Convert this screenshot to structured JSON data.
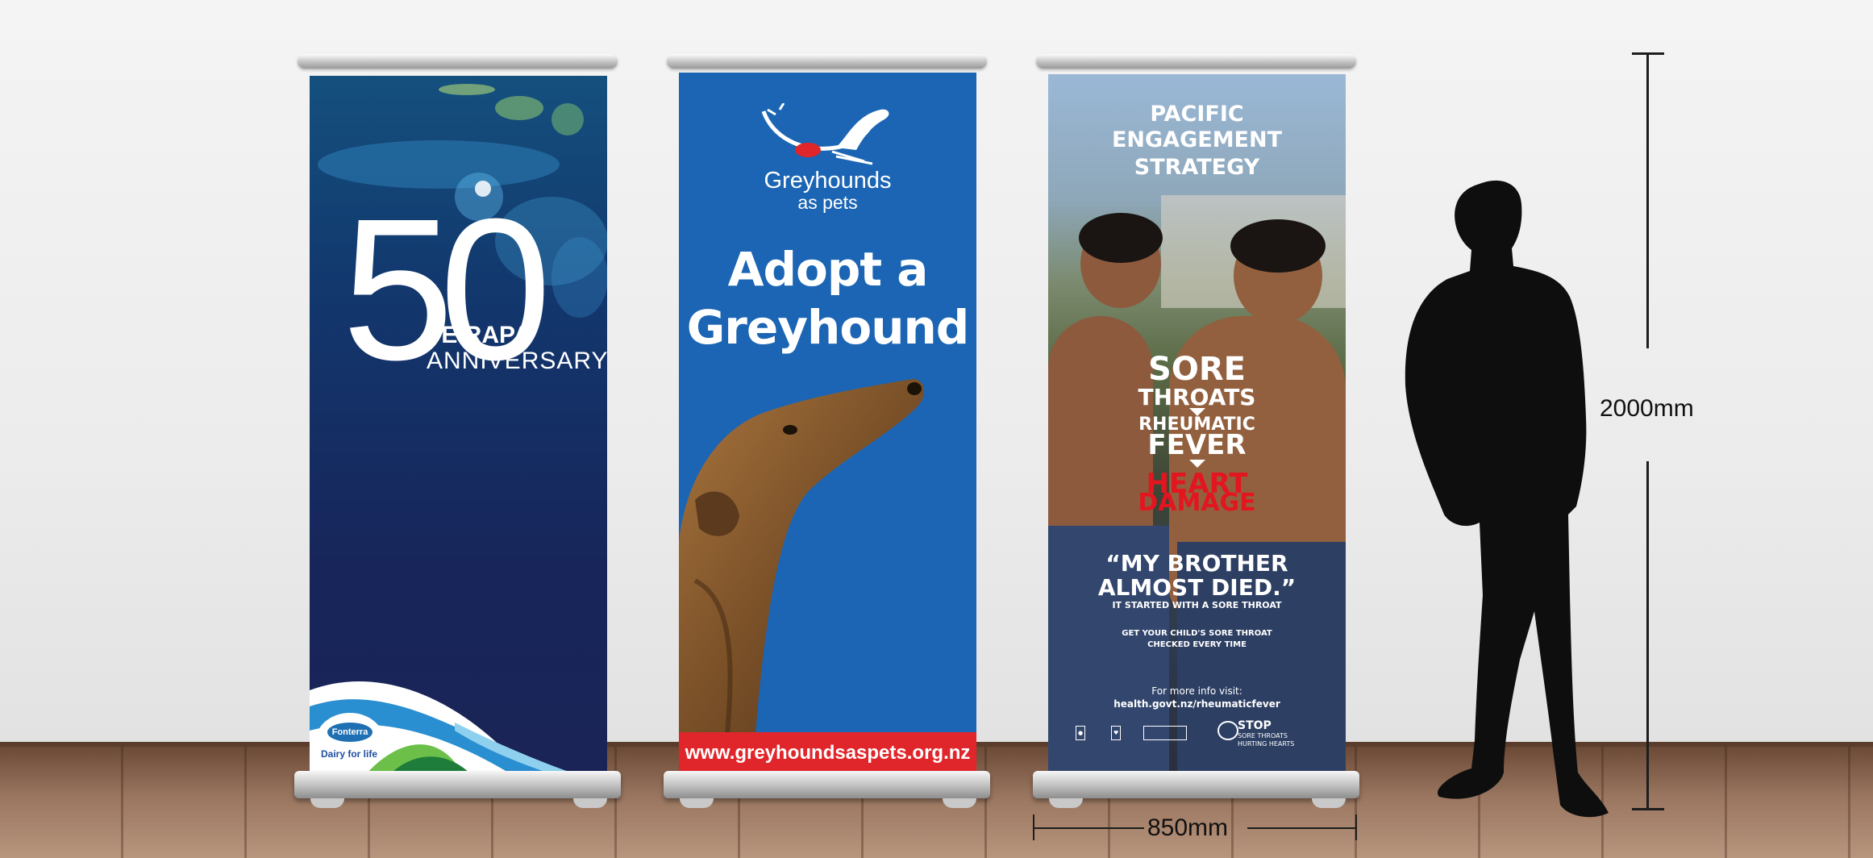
{
  "banner_fonterra": {
    "number": "50",
    "line1": "TE RAPA",
    "line2": "ANNIVERSARY",
    "logo_word": "Fonterra",
    "logo_tagline": "Dairy for life"
  },
  "banner_greyhound": {
    "brand_line1": "Greyhounds",
    "brand_line2": "as pets",
    "headline_line1": "Adopt a",
    "headline_line2": "Greyhound",
    "url": "www.greyhoundsaspets.org.nz"
  },
  "banner_health": {
    "title_line1": "PACIFIC",
    "title_line2": "ENGAGEMENT",
    "title_line3": "STRATEGY",
    "sore": "SORE",
    "throats": "THROATS",
    "rheumatic": "RHEUMATIC",
    "fever": "FEVER",
    "heart": "HEART",
    "damage": "DAMAGE",
    "quote_line1": "“MY BROTHER",
    "quote_line2": "ALMOST DIED.”",
    "quote_sub": "IT STARTED WITH A SORE THROAT",
    "check_line1": "GET YOUR CHILD'S SORE THROAT",
    "check_line2": "CHECKED EVERY TIME",
    "info_line1": "For more info visit:",
    "info_line2": "health.govt.nz/rheumaticfever",
    "stop_line1": "STOP",
    "stop_line2": "SORE THROATS",
    "stop_line3": "HURTING HEARTS"
  },
  "dimensions": {
    "height_label": "2000mm",
    "width_label": "850mm"
  },
  "colors": {
    "fonterra_navy": "#17255a",
    "greyhound_blue": "#1b65b4",
    "url_bar_red": "#e0262a",
    "heart_damage_red": "#e3151f"
  }
}
